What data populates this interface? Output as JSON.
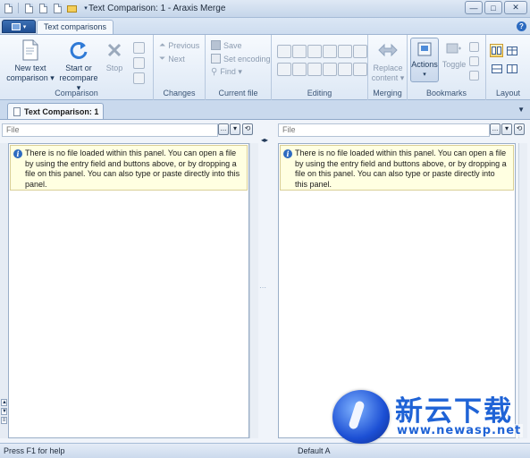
{
  "window": {
    "title": "Text Comparison: 1 - Araxis Merge",
    "buttons": {
      "minimize": "—",
      "maximize": "□",
      "close": "✕"
    }
  },
  "ribbon": {
    "active_tab": "Text comparisons",
    "help": "?",
    "groups": {
      "comparison": {
        "label": "Comparison",
        "new_text_comparison": "New text\ncomparison ▾",
        "start_or_recompare": "Start or\nrecompare ▾",
        "stop": "Stop"
      },
      "changes": {
        "label": "Changes",
        "previous": "Previous",
        "next": "Next"
      },
      "current_file": {
        "label": "Current file",
        "save": "Save",
        "set_encoding": "Set encoding",
        "find": "Find ▾"
      },
      "editing": {
        "label": "Editing"
      },
      "merging": {
        "label": "Merging",
        "replace_content": "Replace\ncontent ▾"
      },
      "bookmarks": {
        "label": "Bookmarks",
        "actions": "Actions",
        "toggle": "Toggle"
      },
      "layout": {
        "label": "Layout"
      }
    }
  },
  "doc_tab": {
    "label": "Text Comparison: 1"
  },
  "panes": {
    "left": {
      "file_placeholder": "File",
      "info": "There is no file loaded within this panel. You can open a file by using the entry field and buttons above, or by dropping a file on this panel. You can also type or paste directly into this panel."
    },
    "right": {
      "file_placeholder": "File",
      "info": "There is no file loaded within this panel. You can open a file by using the entry field and buttons above, or by dropping a file on this panel. You can also type or paste directly into this panel."
    },
    "browse": "...",
    "dropdown": "▾",
    "reload": "⟲",
    "sync": "◂▸"
  },
  "statusbar": {
    "help": "Press F1 for help",
    "encoding": "Default A"
  },
  "watermark": {
    "title": "新云下载",
    "url": "www.newasp.net"
  },
  "colors": {
    "accent": "#1f4e93",
    "ribbon_bg": "#dde8f5",
    "info_bg": "#ffffe1"
  }
}
